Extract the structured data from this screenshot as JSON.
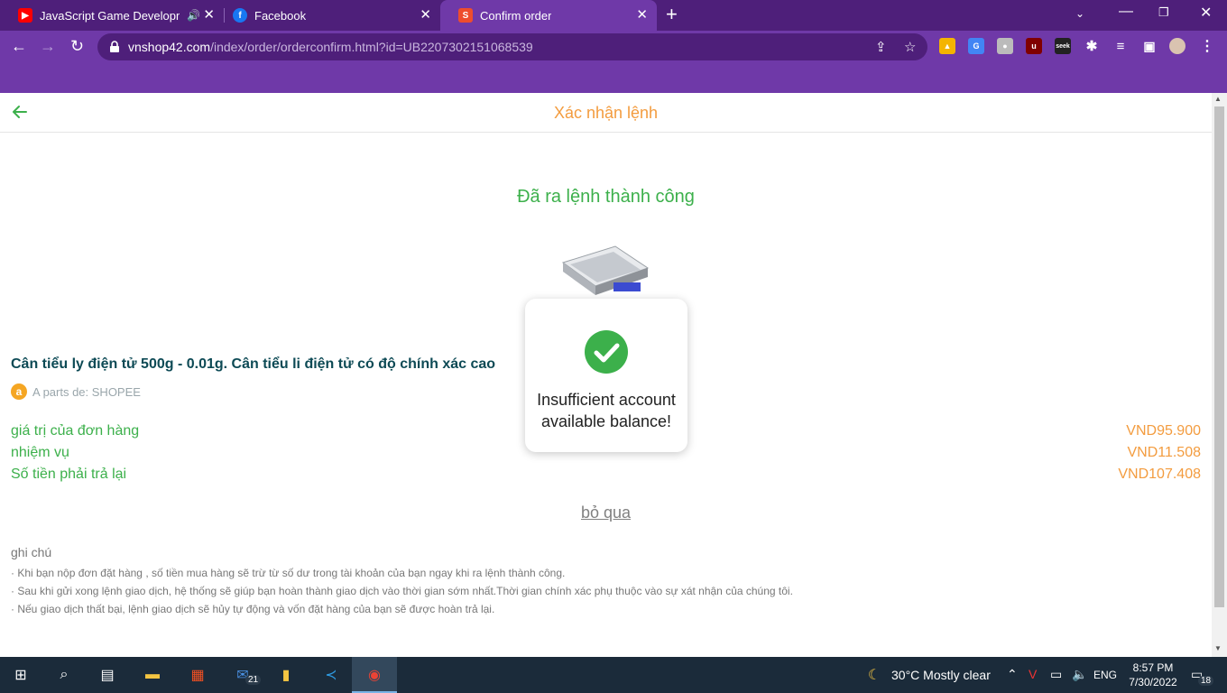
{
  "browser": {
    "tabs": [
      {
        "title": "JavaScript Game Developme",
        "favicon": "youtube-icon",
        "color": "#ff0000"
      },
      {
        "title": "Facebook",
        "favicon": "facebook-icon",
        "color": "#1877f2"
      },
      {
        "title": "Confirm order",
        "favicon": "shop-icon",
        "color": "#ee4d2d"
      }
    ],
    "url_host": "vnshop42.com",
    "url_path": "/index/order/orderconfirm.html?id=UB2207302151068539",
    "theme_color": "#6f39a8"
  },
  "page": {
    "header_title": "Xác nhận lệnh",
    "success_title": "Đã ra lệnh thành công",
    "product_name": "Cân tiểu ly điện tử 500g - 0.01g. Cân tiểu li điện tử có độ chính xác cao",
    "shop_label": "A parts de: SHOPEE",
    "summary": [
      {
        "label": "giá trị của đơn hàng",
        "value": "VND95.900"
      },
      {
        "label": "nhiệm vụ",
        "value": "VND11.508"
      },
      {
        "label": "Số tiền phải trả lại",
        "value": "VND107.408"
      }
    ],
    "skip_label": "bỏ qua",
    "notes_title": "ghi chú",
    "notes": [
      "· Khi bạn nộp đơn đặt hàng , số tiền mua hàng sẽ trừ từ số dư trong tài khoản của bạn ngay khi ra lệnh thành công.",
      "· Sau khi gửi xong lệnh giao dịch, hệ thống sẽ giúp bạn hoàn thành giao dịch vào thời gian sớm nhất.Thời gian chính xác phụ thuộc vào sự xát nhận của chúng tôi.",
      "· Nếu giao dịch thất bại, lệnh giao dịch sẽ hủy tự động và vốn đặt hàng của bạn sẽ được hoàn trả lại."
    ],
    "accent_green": "#3cb04b",
    "accent_orange": "#f39c3f"
  },
  "toast": {
    "message": "Insufficient account available balance!"
  },
  "taskbar": {
    "mail_badge": "21",
    "weather": "30°C  Mostly clear",
    "lang": "ENG",
    "time": "8:57 PM",
    "date": "7/30/2022",
    "notif_badge": "18"
  }
}
